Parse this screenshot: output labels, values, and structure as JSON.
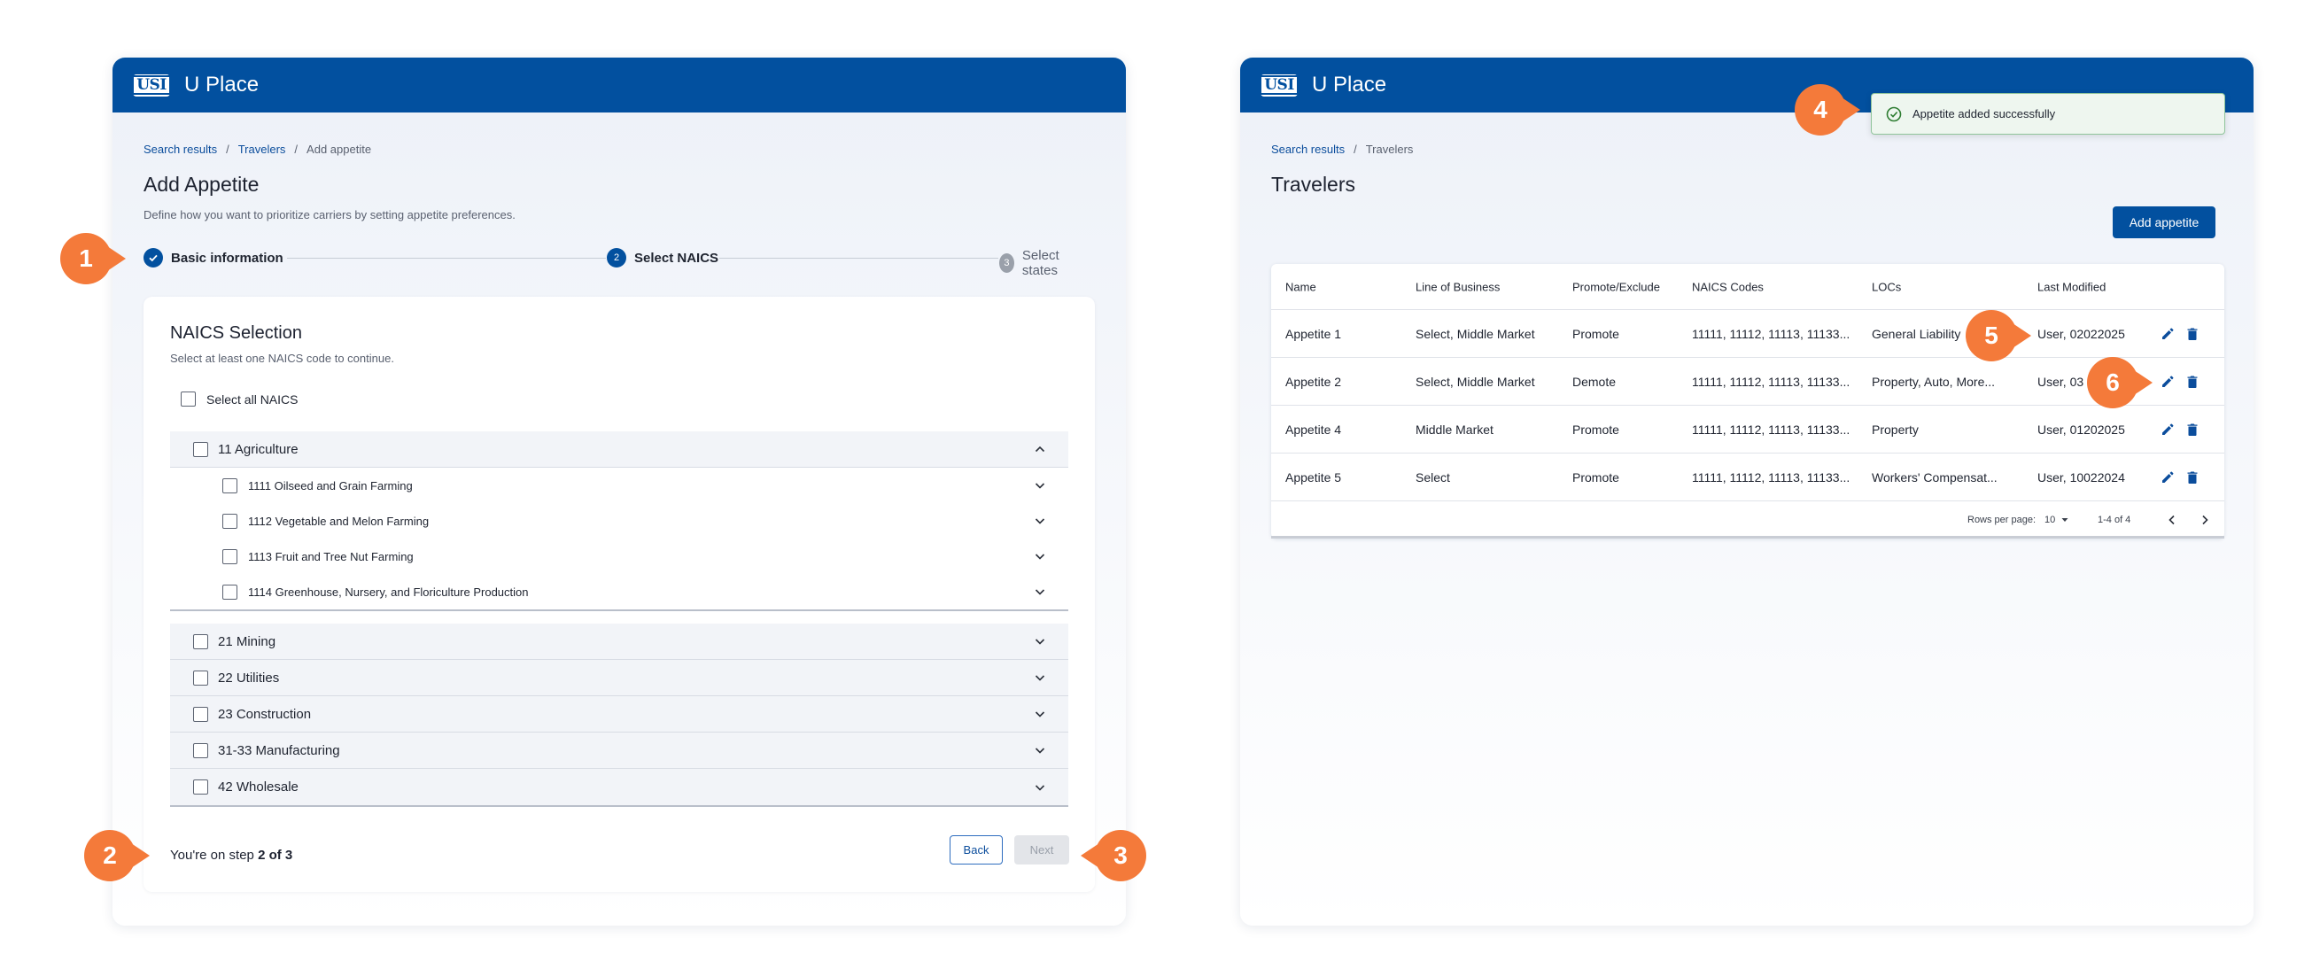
{
  "app": {
    "logo": "USI",
    "title": "U Place"
  },
  "left": {
    "breadcrumb": {
      "item1": "Search results",
      "item2": "Travelers",
      "current": "Add appetite",
      "sep": "/"
    },
    "title": "Add Appetite",
    "description": "Define how you want to prioritize carriers by setting appetite preferences.",
    "steps": [
      {
        "number": "1",
        "label": "Basic information"
      },
      {
        "number": "2",
        "label": "Select NAICS"
      },
      {
        "number": "3",
        "label": "Select states"
      }
    ],
    "naics": {
      "title": "NAICS Selection",
      "subtitle": "Select at least one NAICS code to continue.",
      "select_all": "Select all NAICS",
      "expanded_group": "11 Agriculture",
      "sub_items": [
        "1111 Oilseed and Grain Farming",
        "1112 Vegetable and Melon Farming",
        "1113 Fruit and Tree Nut Farming",
        "1114 Greenhouse, Nursery, and Floriculture Production"
      ],
      "groups": [
        "21 Mining",
        "22 Utilities",
        "23 Construction",
        "31-33 Manufacturing",
        "42 Wholesale"
      ]
    },
    "footer": {
      "step_prefix": "You're on step ",
      "step_value": "2 of 3",
      "back": "Back",
      "next": "Next"
    }
  },
  "right": {
    "breadcrumb": {
      "item1": "Search results",
      "sep": "/",
      "current": "Travelers"
    },
    "title": "Travelers",
    "add_button": "Add appetite",
    "toast": "Appetite added successfully",
    "columns": [
      "Name",
      "Line of Business",
      "Promote/Exclude",
      "NAICS Codes",
      "LOCs",
      "Last Modified"
    ],
    "rows": [
      {
        "name": "Appetite 1",
        "lob": "Select, Middle Market",
        "promote": "Promote",
        "naics": "11111, 11112, 11113, 11133...",
        "locs": "General Liability",
        "modified": "User, 02022025"
      },
      {
        "name": "Appetite 2",
        "lob": "Select, Middle Market",
        "promote": "Demote",
        "naics": "11111, 11112, 11113, 11133...",
        "locs": "Property, Auto, More...",
        "modified": "User, 03"
      },
      {
        "name": "Appetite 4",
        "lob": "Middle Market",
        "promote": "Promote",
        "naics": "11111, 11112, 11113, 11133...",
        "locs": "Property",
        "modified": "User, 01202025"
      },
      {
        "name": "Appetite 5",
        "lob": "Select",
        "promote": "Promote",
        "naics": "11111, 11112, 11113, 11133...",
        "locs": "Workers' Compensat...",
        "modified": "User, 10022024"
      }
    ],
    "pagination": {
      "rows_label": "Rows per page:",
      "rows_value": "10",
      "range": "1-4 of 4"
    }
  },
  "markers": [
    "1",
    "2",
    "3",
    "4",
    "5",
    "6"
  ],
  "colors": {
    "brand": "#02509f",
    "marker": "#f47a3a",
    "success": "#2e7d32"
  }
}
